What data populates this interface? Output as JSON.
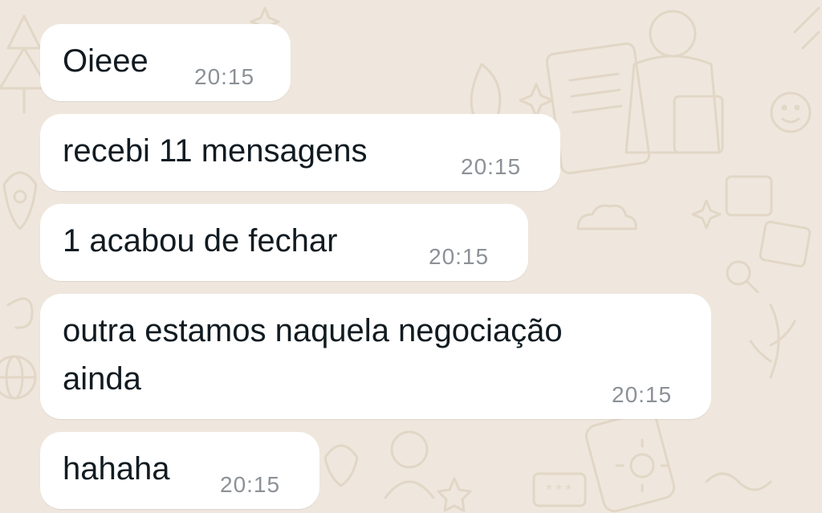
{
  "theme": {
    "wallpaper_color": "#efe7dd",
    "doodle_color": "#e2d6c6",
    "bubble_color": "#ffffff",
    "text_color": "#111b21",
    "time_color": "#8c9197"
  },
  "messages": [
    {
      "lines": [
        "Oieee"
      ],
      "time": "20:15"
    },
    {
      "lines": [
        "recebi 11 mensagens"
      ],
      "time": "20:15"
    },
    {
      "lines": [
        "1 acabou de fechar"
      ],
      "time": "20:15"
    },
    {
      "lines": [
        "outra estamos naquela negociação",
        "ainda"
      ],
      "time": "20:15"
    },
    {
      "lines": [
        "hahaha"
      ],
      "time": "20:15"
    }
  ],
  "decorations": {
    "doodle_text": "***"
  }
}
